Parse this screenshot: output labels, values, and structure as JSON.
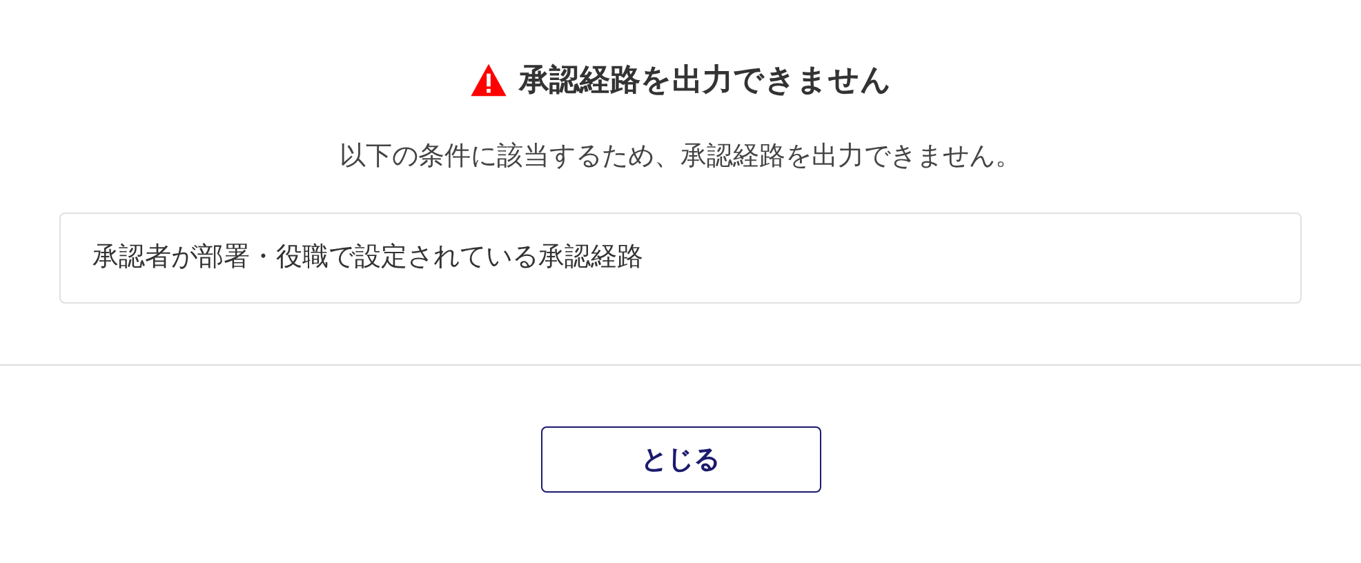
{
  "dialog": {
    "title": "承認経路を出力できません",
    "message": "以下の条件に該当するため、承認経路を出力できません。",
    "conditions": [
      "承認者が部署・役職で設定されている承認経路"
    ],
    "buttons": [
      "とじる"
    ]
  }
}
